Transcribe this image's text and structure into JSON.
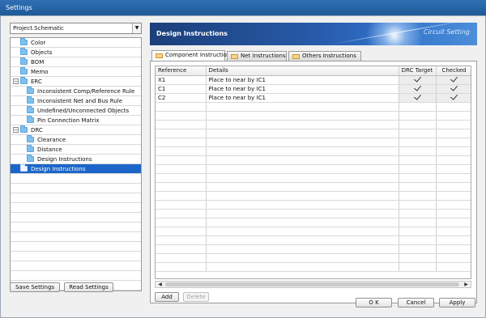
{
  "window": {
    "title": "Settings"
  },
  "project_select": {
    "value": "Project.Schematic"
  },
  "tree": [
    {
      "label": "Color",
      "level": 1,
      "toggle": ""
    },
    {
      "label": "Objects",
      "level": 1,
      "toggle": ""
    },
    {
      "label": "BOM",
      "level": 1,
      "toggle": ""
    },
    {
      "label": "Memo",
      "level": 1,
      "toggle": ""
    },
    {
      "label": "ERC",
      "level": 1,
      "toggle": "−"
    },
    {
      "label": "Inconsistent Comp/Reference Rule",
      "level": 2,
      "toggle": ""
    },
    {
      "label": "Inconsistent Net and Bus Rule",
      "level": 2,
      "toggle": ""
    },
    {
      "label": "Undefined/Unconnected Objects",
      "level": 2,
      "toggle": ""
    },
    {
      "label": "Pin Connection Matrix",
      "level": 2,
      "toggle": ""
    },
    {
      "label": "DRC",
      "level": 1,
      "toggle": "−"
    },
    {
      "label": "Clearance",
      "level": 2,
      "toggle": ""
    },
    {
      "label": "Distance",
      "level": 2,
      "toggle": ""
    },
    {
      "label": "Design Instructions",
      "level": 2,
      "toggle": ""
    },
    {
      "label": "Design Instructions",
      "level": 1,
      "toggle": "",
      "selected": true
    }
  ],
  "left_buttons": {
    "save": "Save Settings",
    "read": "Read Settings"
  },
  "banner": {
    "title": "Design Instructions",
    "right": "Circuit Setting"
  },
  "tabs": [
    {
      "label": "Component Instruction",
      "active": true
    },
    {
      "label": "Net Instructions",
      "active": false
    },
    {
      "label": "Others Instructions",
      "active": false
    }
  ],
  "grid": {
    "headers": {
      "reference": "Reference",
      "details": "Details",
      "drc_target": "DRC Target",
      "checked": "Checked"
    },
    "rows": [
      {
        "reference": "X1",
        "details": "Place to near by IC1",
        "drc_target": true,
        "checked": true
      },
      {
        "reference": "C1",
        "details": "Place to near by IC1",
        "drc_target": true,
        "checked": true
      },
      {
        "reference": "C2",
        "details": "Place to near by IC1",
        "drc_target": true,
        "checked": true
      }
    ]
  },
  "panel_buttons": {
    "add": "Add",
    "delete": "Delete"
  },
  "footer_buttons": {
    "ok": "O K",
    "cancel": "Cancel",
    "apply": "Apply"
  }
}
